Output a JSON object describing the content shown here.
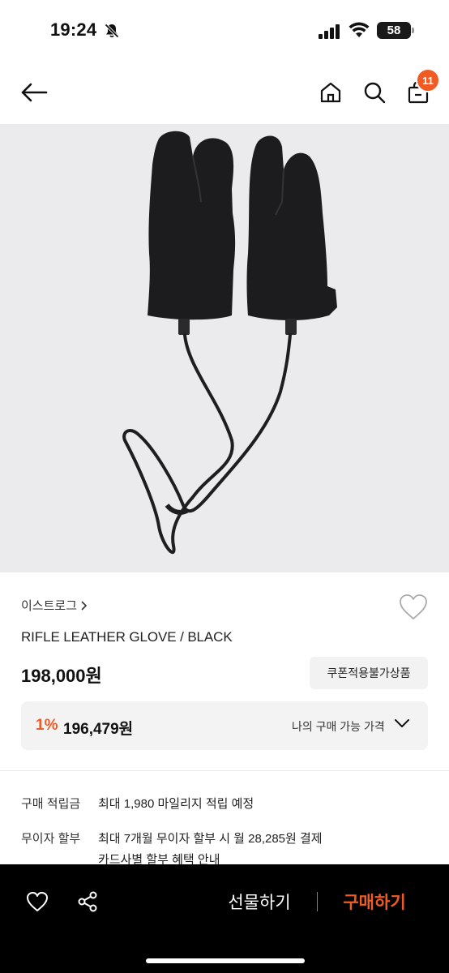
{
  "status_bar": {
    "time": "19:24",
    "battery": "58"
  },
  "header": {
    "cart_count": "11"
  },
  "product": {
    "brand": "이스트로그",
    "name": "RIFLE LEATHER GLOVE / BLACK",
    "price": "198,000원",
    "coupon_note": "쿠폰적용불가상품",
    "discount_rate": "1%",
    "my_price": "196,479원",
    "my_price_label": "나의 구매 가능 가격"
  },
  "details": {
    "points_label": "구매 적립금",
    "points_value": "최대 1,980 마일리지 적립 예정",
    "installment_label": "무이자 할부",
    "installment_value": "최대 7개월 무이자 할부 시 월 28,285원 결제",
    "installment_link": "카드사별 할부 혜택 안내"
  },
  "bottom_bar": {
    "gift_label": "선물하기",
    "buy_label": "구매하기"
  },
  "colors": {
    "accent": "#f15a22",
    "bottom_bar_bg": "#000000",
    "image_bg": "#ebebed"
  }
}
